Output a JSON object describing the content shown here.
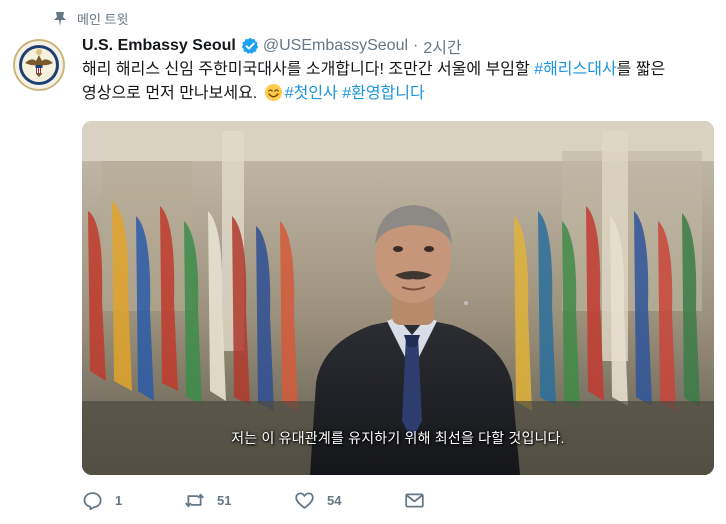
{
  "pinned": {
    "label": "메인 트윗",
    "icon": "pin-icon"
  },
  "author": {
    "display_name": "U.S. Embassy Seoul",
    "verified_icon": "verified-badge-icon",
    "handle": "@USEmbassySeoul",
    "separator": "·",
    "time": "2시간"
  },
  "tweet": {
    "text_1": "해리 해리스 신임 주한미국대사를 소개합니다! 조만간 서울에 부임할 ",
    "hashtag_1": "#해리스대사",
    "text_2": "를 짧은 영상으로 먼저 만나보세요. ",
    "emoji": "smiling-face-emoji",
    "hashtag_2": "#첫인사",
    "space": " ",
    "hashtag_3": "#환영합니다"
  },
  "media": {
    "type": "video",
    "subtitle": "저는 이 유대관계를 유지하기 위해 최선을 다할 것입니다."
  },
  "actions": {
    "reply": {
      "icon": "reply-icon",
      "count": "1"
    },
    "retweet": {
      "icon": "retweet-icon",
      "count": "51"
    },
    "like": {
      "icon": "heart-icon",
      "count": "54"
    },
    "message": {
      "icon": "direct-message-icon"
    }
  },
  "colors": {
    "link": "#1b95e0",
    "secondary_text": "#657786",
    "verified": "#1da1f2"
  }
}
